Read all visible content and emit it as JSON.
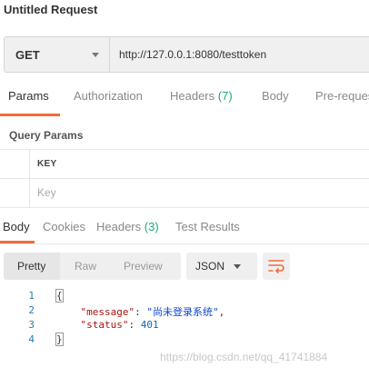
{
  "window": {
    "title": "Untitled Request"
  },
  "request": {
    "method": "GET",
    "url": "http://127.0.0.1:8080/testtoken"
  },
  "request_tabs": [
    {
      "label": "Params",
      "count": "",
      "active": true
    },
    {
      "label": "Authorization",
      "count": "",
      "active": false
    },
    {
      "label": "Headers",
      "count": "(7)",
      "active": false
    },
    {
      "label": "Body",
      "count": "",
      "active": false
    },
    {
      "label": "Pre-reques",
      "count": "",
      "active": false
    }
  ],
  "query_params": {
    "title": "Query Params",
    "column_header": "KEY",
    "key_placeholder": "Key"
  },
  "response_tabs": [
    {
      "label": "Body",
      "count": "",
      "active": true
    },
    {
      "label": "Cookies",
      "count": "",
      "active": false
    },
    {
      "label": "Headers",
      "count": "(3)",
      "active": false
    },
    {
      "label": "Test Results",
      "count": "",
      "active": false
    }
  ],
  "view_modes": {
    "pretty": "Pretty",
    "raw": "Raw",
    "preview": "Preview",
    "selected": "Pretty"
  },
  "format": "JSON",
  "response_body": {
    "lines": [
      {
        "num": "1",
        "open": "{"
      },
      {
        "num": "2",
        "key": "\"message\"",
        "sep": ": ",
        "value": "\"尚未登录系统\"",
        "tail": ","
      },
      {
        "num": "3",
        "key": "\"status\"",
        "sep": ": ",
        "value": "401",
        "tail": ""
      },
      {
        "num": "4",
        "close": "}"
      }
    ]
  },
  "watermark": "https://blog.csdn.net/qq_41741884",
  "colors": {
    "accent": "#f26b3a",
    "count_green": "#19a974"
  },
  "icons": {
    "wrap": "wrap-lines-icon",
    "method_dropdown": "chevron-down-icon",
    "format_dropdown": "chevron-down-icon"
  }
}
